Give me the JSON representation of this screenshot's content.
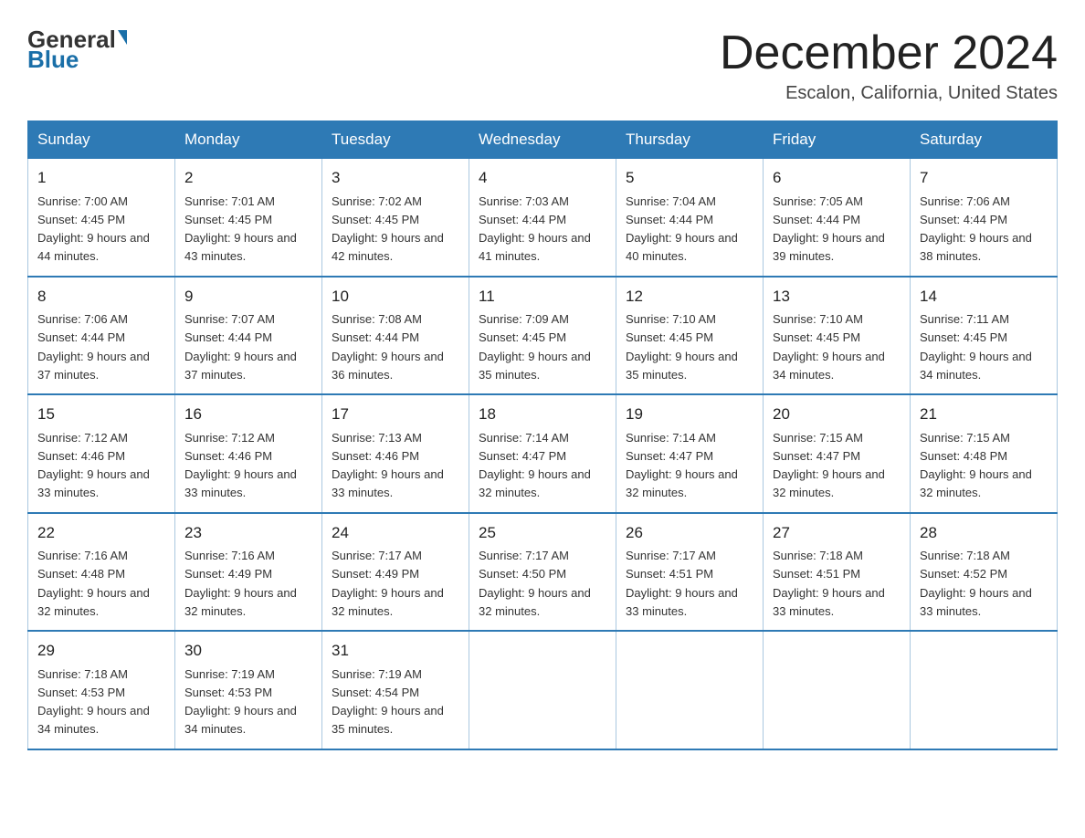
{
  "header": {
    "logo_line1": "General",
    "logo_line2": "Blue",
    "month_title": "December 2024",
    "subtitle": "Escalon, California, United States"
  },
  "weekdays": [
    "Sunday",
    "Monday",
    "Tuesday",
    "Wednesday",
    "Thursday",
    "Friday",
    "Saturday"
  ],
  "weeks": [
    [
      {
        "day": "1",
        "sunrise": "7:00 AM",
        "sunset": "4:45 PM",
        "daylight": "9 hours and 44 minutes."
      },
      {
        "day": "2",
        "sunrise": "7:01 AM",
        "sunset": "4:45 PM",
        "daylight": "9 hours and 43 minutes."
      },
      {
        "day": "3",
        "sunrise": "7:02 AM",
        "sunset": "4:45 PM",
        "daylight": "9 hours and 42 minutes."
      },
      {
        "day": "4",
        "sunrise": "7:03 AM",
        "sunset": "4:44 PM",
        "daylight": "9 hours and 41 minutes."
      },
      {
        "day": "5",
        "sunrise": "7:04 AM",
        "sunset": "4:44 PM",
        "daylight": "9 hours and 40 minutes."
      },
      {
        "day": "6",
        "sunrise": "7:05 AM",
        "sunset": "4:44 PM",
        "daylight": "9 hours and 39 minutes."
      },
      {
        "day": "7",
        "sunrise": "7:06 AM",
        "sunset": "4:44 PM",
        "daylight": "9 hours and 38 minutes."
      }
    ],
    [
      {
        "day": "8",
        "sunrise": "7:06 AM",
        "sunset": "4:44 PM",
        "daylight": "9 hours and 37 minutes."
      },
      {
        "day": "9",
        "sunrise": "7:07 AM",
        "sunset": "4:44 PM",
        "daylight": "9 hours and 37 minutes."
      },
      {
        "day": "10",
        "sunrise": "7:08 AM",
        "sunset": "4:44 PM",
        "daylight": "9 hours and 36 minutes."
      },
      {
        "day": "11",
        "sunrise": "7:09 AM",
        "sunset": "4:45 PM",
        "daylight": "9 hours and 35 minutes."
      },
      {
        "day": "12",
        "sunrise": "7:10 AM",
        "sunset": "4:45 PM",
        "daylight": "9 hours and 35 minutes."
      },
      {
        "day": "13",
        "sunrise": "7:10 AM",
        "sunset": "4:45 PM",
        "daylight": "9 hours and 34 minutes."
      },
      {
        "day": "14",
        "sunrise": "7:11 AM",
        "sunset": "4:45 PM",
        "daylight": "9 hours and 34 minutes."
      }
    ],
    [
      {
        "day": "15",
        "sunrise": "7:12 AM",
        "sunset": "4:46 PM",
        "daylight": "9 hours and 33 minutes."
      },
      {
        "day": "16",
        "sunrise": "7:12 AM",
        "sunset": "4:46 PM",
        "daylight": "9 hours and 33 minutes."
      },
      {
        "day": "17",
        "sunrise": "7:13 AM",
        "sunset": "4:46 PM",
        "daylight": "9 hours and 33 minutes."
      },
      {
        "day": "18",
        "sunrise": "7:14 AM",
        "sunset": "4:47 PM",
        "daylight": "9 hours and 32 minutes."
      },
      {
        "day": "19",
        "sunrise": "7:14 AM",
        "sunset": "4:47 PM",
        "daylight": "9 hours and 32 minutes."
      },
      {
        "day": "20",
        "sunrise": "7:15 AM",
        "sunset": "4:47 PM",
        "daylight": "9 hours and 32 minutes."
      },
      {
        "day": "21",
        "sunrise": "7:15 AM",
        "sunset": "4:48 PM",
        "daylight": "9 hours and 32 minutes."
      }
    ],
    [
      {
        "day": "22",
        "sunrise": "7:16 AM",
        "sunset": "4:48 PM",
        "daylight": "9 hours and 32 minutes."
      },
      {
        "day": "23",
        "sunrise": "7:16 AM",
        "sunset": "4:49 PM",
        "daylight": "9 hours and 32 minutes."
      },
      {
        "day": "24",
        "sunrise": "7:17 AM",
        "sunset": "4:49 PM",
        "daylight": "9 hours and 32 minutes."
      },
      {
        "day": "25",
        "sunrise": "7:17 AM",
        "sunset": "4:50 PM",
        "daylight": "9 hours and 32 minutes."
      },
      {
        "day": "26",
        "sunrise": "7:17 AM",
        "sunset": "4:51 PM",
        "daylight": "9 hours and 33 minutes."
      },
      {
        "day": "27",
        "sunrise": "7:18 AM",
        "sunset": "4:51 PM",
        "daylight": "9 hours and 33 minutes."
      },
      {
        "day": "28",
        "sunrise": "7:18 AM",
        "sunset": "4:52 PM",
        "daylight": "9 hours and 33 minutes."
      }
    ],
    [
      {
        "day": "29",
        "sunrise": "7:18 AM",
        "sunset": "4:53 PM",
        "daylight": "9 hours and 34 minutes."
      },
      {
        "day": "30",
        "sunrise": "7:19 AM",
        "sunset": "4:53 PM",
        "daylight": "9 hours and 34 minutes."
      },
      {
        "day": "31",
        "sunrise": "7:19 AM",
        "sunset": "4:54 PM",
        "daylight": "9 hours and 35 minutes."
      },
      null,
      null,
      null,
      null
    ]
  ]
}
